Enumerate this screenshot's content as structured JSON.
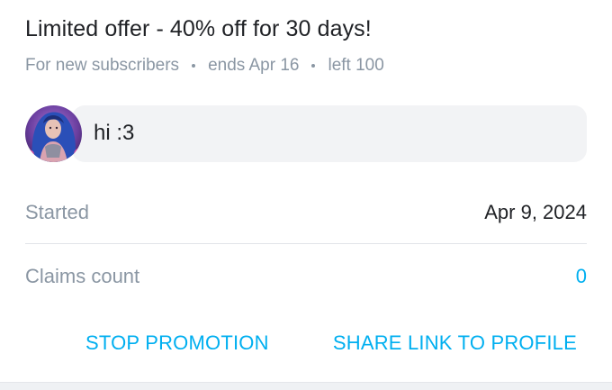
{
  "offer": {
    "title": "Limited offer - 40% off for 30 days!",
    "audience": "For new subscribers",
    "ends": "ends Apr 16",
    "left": "left 100"
  },
  "message": {
    "avatar_icon": "user-avatar",
    "text": "hi :3"
  },
  "details": {
    "started_label": "Started",
    "started_value": "Apr 9, 2024",
    "claims_label": "Claims count",
    "claims_value": "0"
  },
  "actions": {
    "stop_label": "STOP PROMOTION",
    "share_label": "SHARE LINK TO PROFILE"
  },
  "colors": {
    "accent": "#00aff0",
    "muted": "#8a96a3",
    "text": "#1f2125",
    "bubble": "#f2f3f5"
  }
}
